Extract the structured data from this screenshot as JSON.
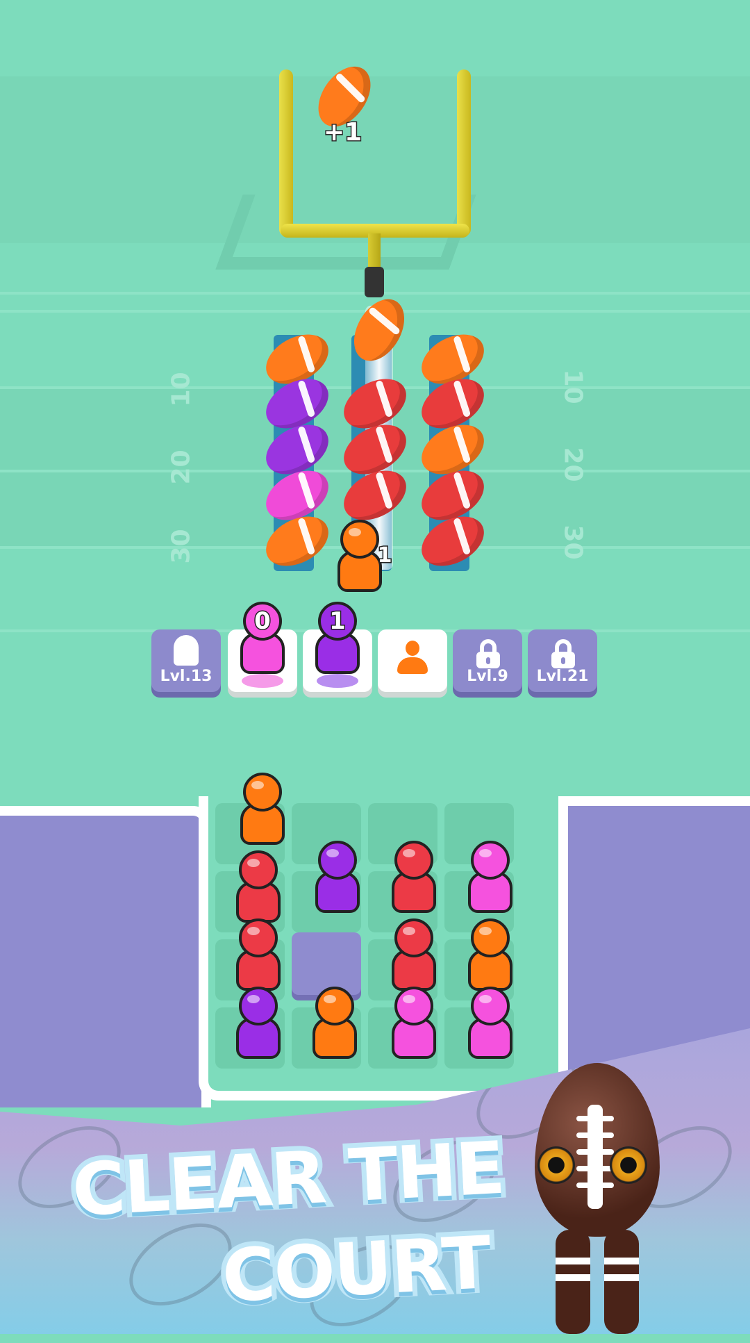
{
  "score_popup": "+1",
  "yard_numbers": {
    "left": [
      "10",
      "20",
      "30"
    ],
    "right": [
      "10",
      "20",
      "30"
    ]
  },
  "ball_columns": [
    [
      "orange",
      "purple",
      "purple",
      "pink",
      "orange"
    ],
    [
      "orange",
      "red",
      "red",
      "red"
    ],
    [
      "orange",
      "red",
      "orange",
      "red",
      "red"
    ]
  ],
  "launching_player": {
    "color": "orange",
    "count": "1"
  },
  "slots": [
    {
      "state": "locked",
      "label": "Lvl.13"
    },
    {
      "state": "occupied",
      "player_color": "pink",
      "count": "0"
    },
    {
      "state": "occupied",
      "player_color": "purple",
      "count": "1"
    },
    {
      "state": "empty",
      "icon": "user-icon"
    },
    {
      "state": "locked",
      "label": "Lvl.9",
      "icon": "lock-icon"
    },
    {
      "state": "locked",
      "label": "Lvl.21",
      "icon": "lock-icon"
    }
  ],
  "court_grid": [
    [
      "orange",
      "",
      "",
      ""
    ],
    [
      "red",
      "purple",
      "red",
      "pink"
    ],
    [
      "red",
      "hole",
      "red",
      "orange"
    ],
    [
      "purple",
      "orange",
      "pink",
      "pink"
    ]
  ],
  "banner": {
    "line1": "CLEAR THE",
    "line2": "COURT"
  },
  "colors": {
    "field": "#7ddcbc",
    "wing": "#8f8ccf",
    "locked_slot": "#8d8acc",
    "orange": "#ff7a12",
    "red": "#ec3a46",
    "purple": "#9a2ee6",
    "pink": "#f552de"
  }
}
